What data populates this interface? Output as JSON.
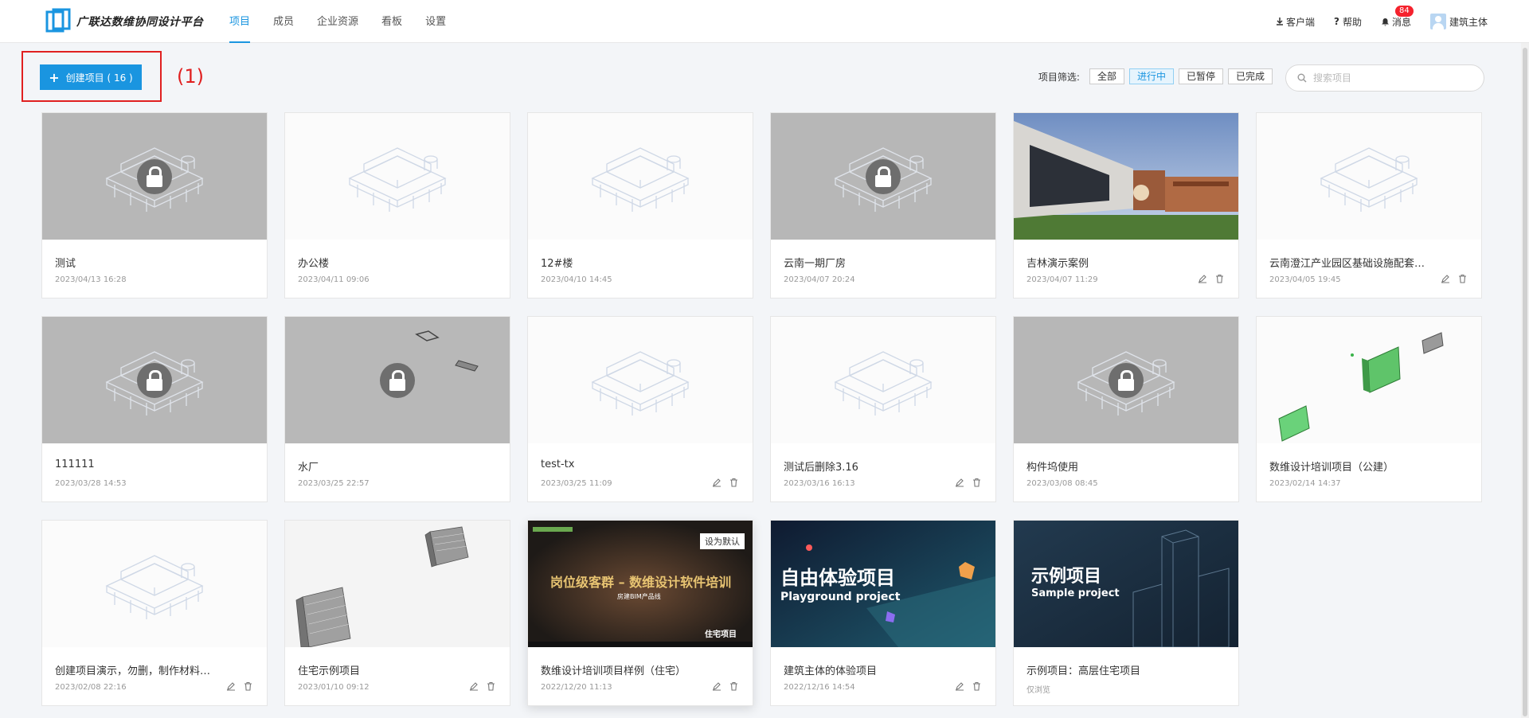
{
  "header": {
    "logo_text": "广联达数维协同设计平台",
    "nav": [
      {
        "label": "项目",
        "active": true
      },
      {
        "label": "成员",
        "active": false
      },
      {
        "label": "企业资源",
        "active": false
      },
      {
        "label": "看板",
        "active": false
      },
      {
        "label": "设置",
        "active": false
      }
    ],
    "right": {
      "download_label": "客户端",
      "help_label": "帮助",
      "messages_label": "消息",
      "messages_count": "84",
      "user_label": "建筑主体"
    }
  },
  "toolbar": {
    "create_label": "创建项目 ( 16 )",
    "annotation": "(1)",
    "filter_label": "项目筛选:",
    "filters": [
      {
        "label": "全部",
        "active": false
      },
      {
        "label": "进行中",
        "active": true
      },
      {
        "label": "已暂停",
        "active": false
      },
      {
        "label": "已完成",
        "active": false
      }
    ],
    "search_placeholder": "搜索项目"
  },
  "projects": [
    {
      "title": "测试",
      "date": "2023/04/13 16:28",
      "thumb": "building-locked"
    },
    {
      "title": "办公楼",
      "date": "2023/04/11 09:06",
      "thumb": "building"
    },
    {
      "title": "12#楼",
      "date": "2023/04/10 14:45",
      "thumb": "building"
    },
    {
      "title": "云南一期厂房",
      "date": "2023/04/07 20:24",
      "thumb": "building-locked"
    },
    {
      "title": "吉林演示案例",
      "date": "2023/04/07 11:29",
      "thumb": "photo",
      "actions": true
    },
    {
      "title": "云南澄江产业园区基础设施配套工程项...",
      "date": "2023/04/05 19:45",
      "thumb": "building",
      "actions": true
    },
    {
      "title": "111111",
      "date": "2023/03/28 14:53",
      "thumb": "building-locked"
    },
    {
      "title": "水厂",
      "date": "2023/03/25 22:57",
      "thumb": "model-locked"
    },
    {
      "title": "test-tx",
      "date": "2023/03/25 11:09",
      "thumb": "building",
      "actions": true
    },
    {
      "title": "测试后删除3.16",
      "date": "2023/03/16 16:13",
      "thumb": "building",
      "actions": true
    },
    {
      "title": "构件坞使用",
      "date": "2023/03/08 08:45",
      "thumb": "building-locked"
    },
    {
      "title": "数维设计培训项目（公建）",
      "date": "2023/02/14 14:37",
      "thumb": "green-models"
    },
    {
      "title": "创建项目演示，勿删，制作材料使用，...",
      "date": "2023/02/08 22:16",
      "thumb": "building",
      "actions": true
    },
    {
      "title": "住宅示例项目",
      "date": "2023/01/10 09:12",
      "thumb": "tower-models",
      "actions": true
    },
    {
      "title": "数维设计培训项目样例（住宅）",
      "date": "2022/12/20 11:13",
      "thumb": "training",
      "actions": true,
      "overlay": {
        "default_tag": "设为默认",
        "headline": "岗位级客群 – 数维设计软件培训",
        "sub": "房建BIM产品线",
        "corner": "住宅项目"
      }
    },
    {
      "title": "建筑主体的体验项目",
      "date": "2022/12/16 14:54",
      "thumb": "playground",
      "actions": true,
      "overlay": {
        "headline": "自由体验项目",
        "sub": "Playground project"
      }
    },
    {
      "title": "示例项目：高层住宅项目",
      "date": "仅浏览",
      "thumb": "sample",
      "overlay": {
        "headline": "示例项目",
        "sub": "Sample project"
      }
    }
  ]
}
